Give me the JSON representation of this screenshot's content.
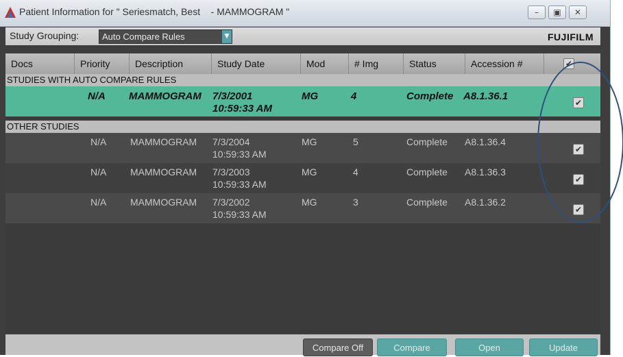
{
  "window": {
    "title": "Patient Information for \" Seriesmatch, Best    - MAMMOGRAM \"",
    "minimize_label": "–",
    "restore_label": "▣",
    "close_label": "✕"
  },
  "grouping": {
    "label": "Study Grouping:",
    "selected": "Auto Compare Rules",
    "brand": "FUJIFILM"
  },
  "table": {
    "columns": [
      "Docs",
      "Priority",
      "Description",
      "Study Date",
      "Mod",
      "# Img",
      "Status",
      "Accession #"
    ],
    "select_all": "✔",
    "sections": [
      {
        "title": "STUDIES WITH AUTO COMPARE RULES",
        "rows": [
          {
            "docs": "",
            "priority": "N/A",
            "description": "MAMMOGRAM",
            "date": "7/3/2001",
            "time": "10:59:33 AM",
            "mod": "MG",
            "img": "4",
            "status": "Complete",
            "accession": "A8.1.36.1",
            "checked": "✔"
          }
        ]
      },
      {
        "title": "OTHER STUDIES",
        "rows": [
          {
            "docs": "",
            "priority": "N/A",
            "description": "MAMMOGRAM",
            "date": "7/3/2004",
            "time": "10:59:33 AM",
            "mod": "MG",
            "img": "5",
            "status": "Complete",
            "accession": "A8.1.36.4",
            "checked": "✔"
          },
          {
            "docs": "",
            "priority": "N/A",
            "description": "MAMMOGRAM",
            "date": "7/3/2003",
            "time": "10:59:33 AM",
            "mod": "MG",
            "img": "4",
            "status": "Complete",
            "accession": "A8.1.36.3",
            "checked": "✔"
          },
          {
            "docs": "",
            "priority": "N/A",
            "description": "MAMMOGRAM",
            "date": "7/3/2002",
            "time": "10:59:33 AM",
            "mod": "MG",
            "img": "3",
            "status": "Complete",
            "accession": "A8.1.36.2",
            "checked": "✔"
          }
        ]
      }
    ]
  },
  "footer": {
    "compare_off": "Compare Off",
    "compare": "Compare",
    "open": "Open",
    "update": "Update"
  },
  "colors": {
    "highlight_row": "#53b79a",
    "accent_button": "#5aa6a4",
    "annotation": "#2f4f7f"
  }
}
